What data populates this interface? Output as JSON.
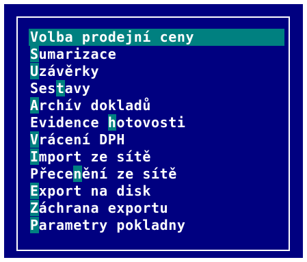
{
  "menu": {
    "items": [
      {
        "pre": "",
        "key": "V",
        "post": "olba prodejní ceny",
        "selected": true
      },
      {
        "pre": "",
        "key": "S",
        "post": "umarizace",
        "selected": false
      },
      {
        "pre": "",
        "key": "U",
        "post": "závěrky",
        "selected": false
      },
      {
        "pre": "Ses",
        "key": "t",
        "post": "avy",
        "selected": false
      },
      {
        "pre": "",
        "key": "A",
        "post": "rchív dokladů",
        "selected": false
      },
      {
        "pre": "Evidence ",
        "key": "h",
        "post": "otovosti",
        "selected": false
      },
      {
        "pre": "",
        "key": "V",
        "post": "rácení DPH",
        "selected": false
      },
      {
        "pre": "",
        "key": "I",
        "post": "mport ze sítě",
        "selected": false
      },
      {
        "pre": "Přece",
        "key": "n",
        "post": "ění ze sítě",
        "selected": false
      },
      {
        "pre": "",
        "key": "E",
        "post": "xport na disk",
        "selected": false
      },
      {
        "pre": "",
        "key": "Z",
        "post": "áchrana exportu",
        "selected": false
      },
      {
        "pre": "",
        "key": "P",
        "post": "arametry pokladny",
        "selected": false
      }
    ]
  },
  "colors": {
    "background": "#000080",
    "text": "#ffffff",
    "highlight": "#008080"
  }
}
